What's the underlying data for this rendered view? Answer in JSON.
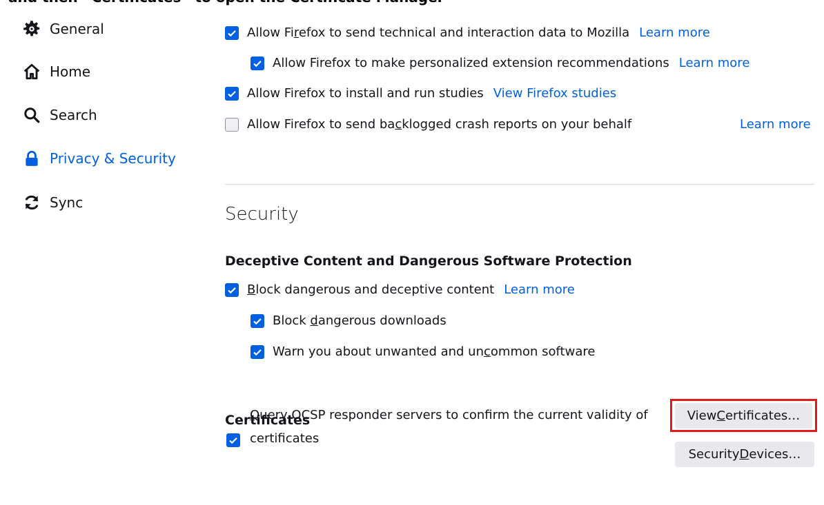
{
  "header_cutoff": "and then “Certificates” to open the Certificate Manager",
  "sidebar": {
    "items": [
      {
        "label": "General",
        "icon": "gear-icon",
        "selected": false
      },
      {
        "label": "Home",
        "icon": "home-icon",
        "selected": false
      },
      {
        "label": "Search",
        "icon": "search-icon",
        "selected": false
      },
      {
        "label": "Privacy & Security",
        "icon": "lock-icon",
        "selected": true
      },
      {
        "label": "Sync",
        "icon": "sync-icon",
        "selected": false
      }
    ]
  },
  "data_collection": {
    "technical_data": {
      "pre": "Allow Fi",
      "key": "r",
      "post": "efox to send technical and interaction data to Mozilla",
      "checked": true,
      "link": "Learn more"
    },
    "extension_recs": {
      "label": "Allow Firefox to make personalized extension recommendations",
      "checked": true,
      "link": "Learn more"
    },
    "studies": {
      "label": "Allow Firefox to install and run studies",
      "checked": true,
      "link": "View Firefox studies"
    },
    "crash_reports": {
      "pre": "Allow Firefox to send ba",
      "key": "c",
      "post": "klogged crash reports on your behalf",
      "checked": false,
      "link": "Learn more"
    }
  },
  "security": {
    "title": "Security",
    "deceptive": {
      "heading": "Deceptive Content and Dangerous Software Protection",
      "block_content": {
        "key": "B",
        "post": "lock dangerous and deceptive content",
        "checked": true,
        "link": "Learn more"
      },
      "block_downloads": {
        "pre": "Block ",
        "key": "d",
        "post": "angerous downloads",
        "checked": true
      },
      "warn_unwanted": {
        "pre": "Warn you about unwanted and un",
        "key": "c",
        "post": "ommon software",
        "checked": true
      }
    },
    "certificates": {
      "heading": "Certificates",
      "ocsp": {
        "key": "Q",
        "line1_post": "uery OCSP responder servers to confirm the current validity of",
        "line2": "certificates",
        "checked": true
      },
      "view_button": {
        "pre": "View ",
        "key": "C",
        "post": "ertificates…"
      },
      "devices_button": {
        "pre": "Security ",
        "key": "D",
        "post": "evices…"
      }
    }
  },
  "colors": {
    "accent": "#0060df",
    "highlight": "#e31a1a",
    "button_bg": "#e9e9ed"
  }
}
